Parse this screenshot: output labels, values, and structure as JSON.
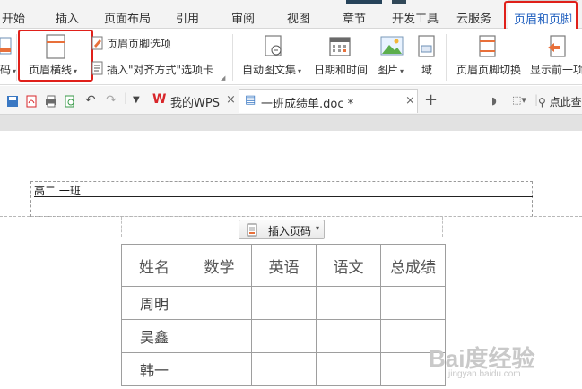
{
  "menu": {
    "tabs": [
      "开始",
      "插入",
      "页面布局",
      "引用",
      "审阅",
      "视图",
      "章节",
      "开发工具",
      "云服务"
    ],
    "active_tab": "页眉和页脚"
  },
  "ribbon": {
    "left_partial": "码",
    "header_line_label": "页眉横线",
    "header_footer_options": "页眉页脚选项",
    "insert_align_tab": "插入\"对齐方式\"选项卡",
    "auto_text": "自动图文集",
    "date_time": "日期和时间",
    "picture": "图片",
    "field": "域",
    "switch_header_footer": "页眉页脚切换",
    "show_previous": "显示前一项"
  },
  "docbar": {
    "wps_tab": "我的WPS",
    "doc_tab": "一班成绩单.doc *",
    "search_partial": "点此查"
  },
  "document": {
    "header_text": "高二  一班",
    "insert_page_number": "插入页码",
    "table": {
      "columns": [
        "姓名",
        "数学",
        "英语",
        "语文",
        "总成绩"
      ],
      "rows": [
        [
          "周明",
          "",
          "",
          "",
          ""
        ],
        [
          "吴鑫",
          "",
          "",
          "",
          ""
        ],
        [
          "韩一",
          "",
          "",
          "",
          ""
        ]
      ]
    }
  },
  "watermark": {
    "brand": "Bai度经验",
    "url": "jingyan.baidu.com"
  },
  "colors": {
    "active_tab": "#1f5fbf",
    "highlight": "#e0201a",
    "wps_red": "#d8262a"
  }
}
